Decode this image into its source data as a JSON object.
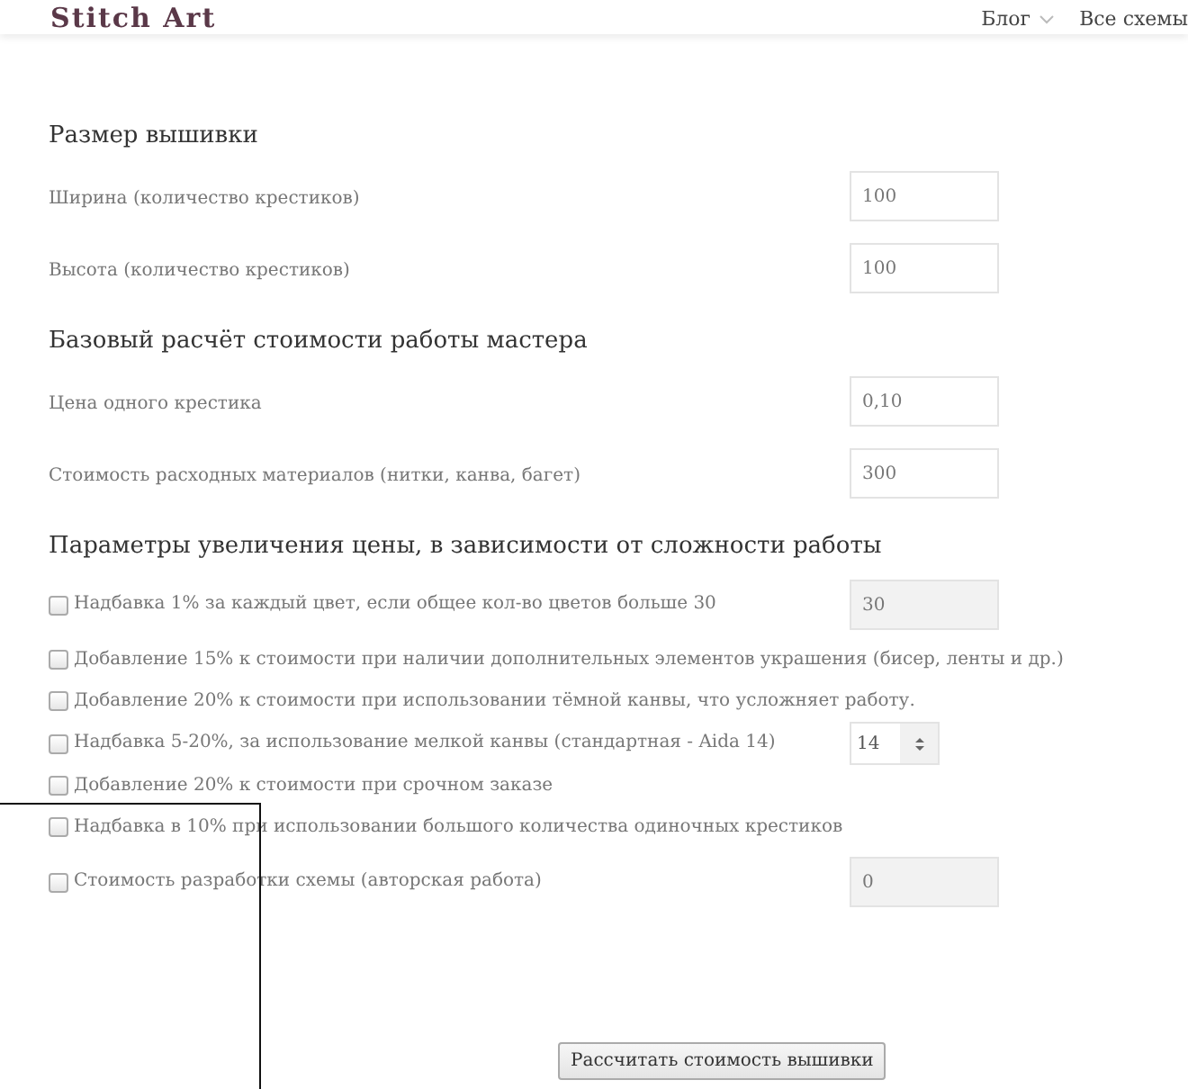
{
  "header": {
    "logo": "Stitch Art",
    "nav": [
      {
        "label": "Блог",
        "dropdown": true
      },
      {
        "label": "Все схемы",
        "dropdown": false
      }
    ]
  },
  "sections": [
    {
      "title": "Размер вышивки",
      "fields": [
        {
          "label": "Ширина (количество крестиков)",
          "value": "100"
        },
        {
          "label": "Высота (количество крестиков)",
          "value": "100"
        }
      ]
    },
    {
      "title": "Базовый расчёт стоимости работы мастера",
      "fields": [
        {
          "label": "Цена одного крестика",
          "value": "0,10"
        },
        {
          "label": "Стоимость расходных материалов (нитки, канва, багет)",
          "value": "300"
        }
      ]
    }
  ],
  "options_title": "Параметры увеличения цены, в зависимости от сложности работы",
  "options": [
    {
      "label": "Надбавка 1% за каждый цвет, если общее кол-во цветов больше 30",
      "checked": false,
      "kind": "input",
      "value": "30",
      "disabled": true
    },
    {
      "label": "Добавление 15% к стоимости при наличии дополнительных элементов украшения (бисер, ленты и др.)",
      "checked": false,
      "kind": "plain"
    },
    {
      "label": "Добавление 20% к стоимости при использовании тёмной канвы, что усложняет работу.",
      "checked": false,
      "kind": "plain"
    },
    {
      "label": "Надбавка 5-20%, за использование мелкой канвы (стандартная - Aida 14)",
      "checked": false,
      "kind": "spinner",
      "value": "14"
    },
    {
      "label": "Добавление 20% к стоимости при срочном заказе",
      "checked": false,
      "kind": "plain"
    },
    {
      "label": "Надбавка в 10% при использовании большого количества одиночных крестиков",
      "checked": false,
      "kind": "plain"
    },
    {
      "label": "Стоимость разработки схемы (авторская работа)",
      "checked": false,
      "kind": "input",
      "value": "0",
      "disabled": true
    }
  ],
  "submit": "Рассчитать стоимость вышивки"
}
